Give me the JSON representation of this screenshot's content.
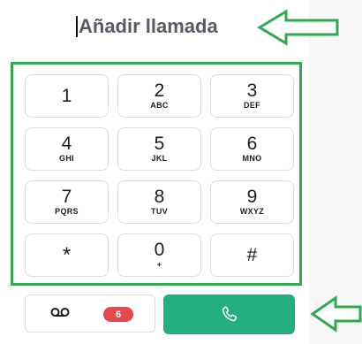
{
  "header": {
    "title": "Añadir llamada"
  },
  "keypad": {
    "keys": [
      {
        "digit": "1",
        "letters": ""
      },
      {
        "digit": "2",
        "letters": "ABC"
      },
      {
        "digit": "3",
        "letters": "DEF"
      },
      {
        "digit": "4",
        "letters": "GHI"
      },
      {
        "digit": "5",
        "letters": "JKL"
      },
      {
        "digit": "6",
        "letters": "MNO"
      },
      {
        "digit": "7",
        "letters": "PQRS"
      },
      {
        "digit": "8",
        "letters": "TUV"
      },
      {
        "digit": "9",
        "letters": "WXYZ"
      },
      {
        "digit": "*",
        "letters": ""
      },
      {
        "digit": "0",
        "letters": "+"
      },
      {
        "digit": "#",
        "letters": ""
      }
    ]
  },
  "voicemail": {
    "icon": "voicemail-icon",
    "badge_count": "6"
  },
  "call": {
    "icon": "phone-icon"
  },
  "colors": {
    "highlight_frame": "#2fa84f",
    "call_button": "#23b07e",
    "badge": "#e5484d",
    "title_text": "#555c66"
  }
}
